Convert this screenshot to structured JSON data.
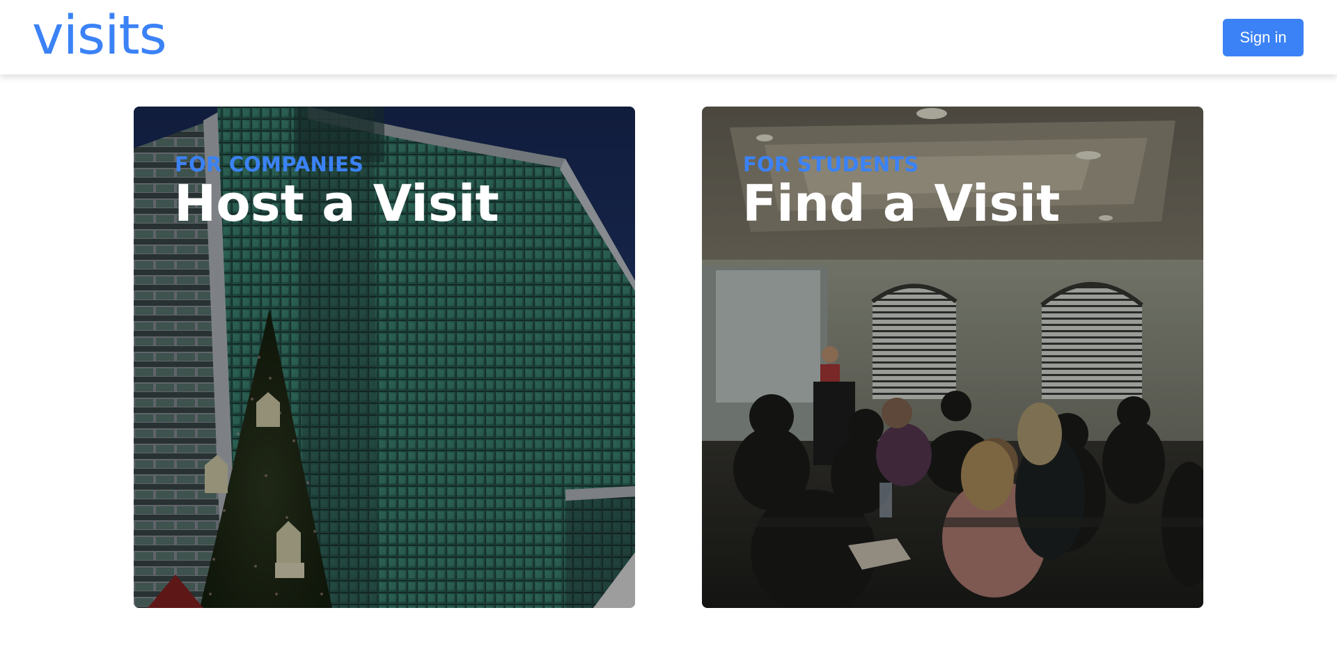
{
  "header": {
    "logo": "visits",
    "signin_label": "Sign in"
  },
  "cards": [
    {
      "kicker": "FOR COMPANIES",
      "title": "Host a Visit",
      "image": "office-building-with-christmas-tree"
    },
    {
      "kicker": "FOR STUDENTS",
      "title": "Find a Visit",
      "image": "classroom-presentation"
    }
  ],
  "colors": {
    "accent": "#3b82f6",
    "card_title": "#ffffff",
    "background": "#ffffff"
  }
}
